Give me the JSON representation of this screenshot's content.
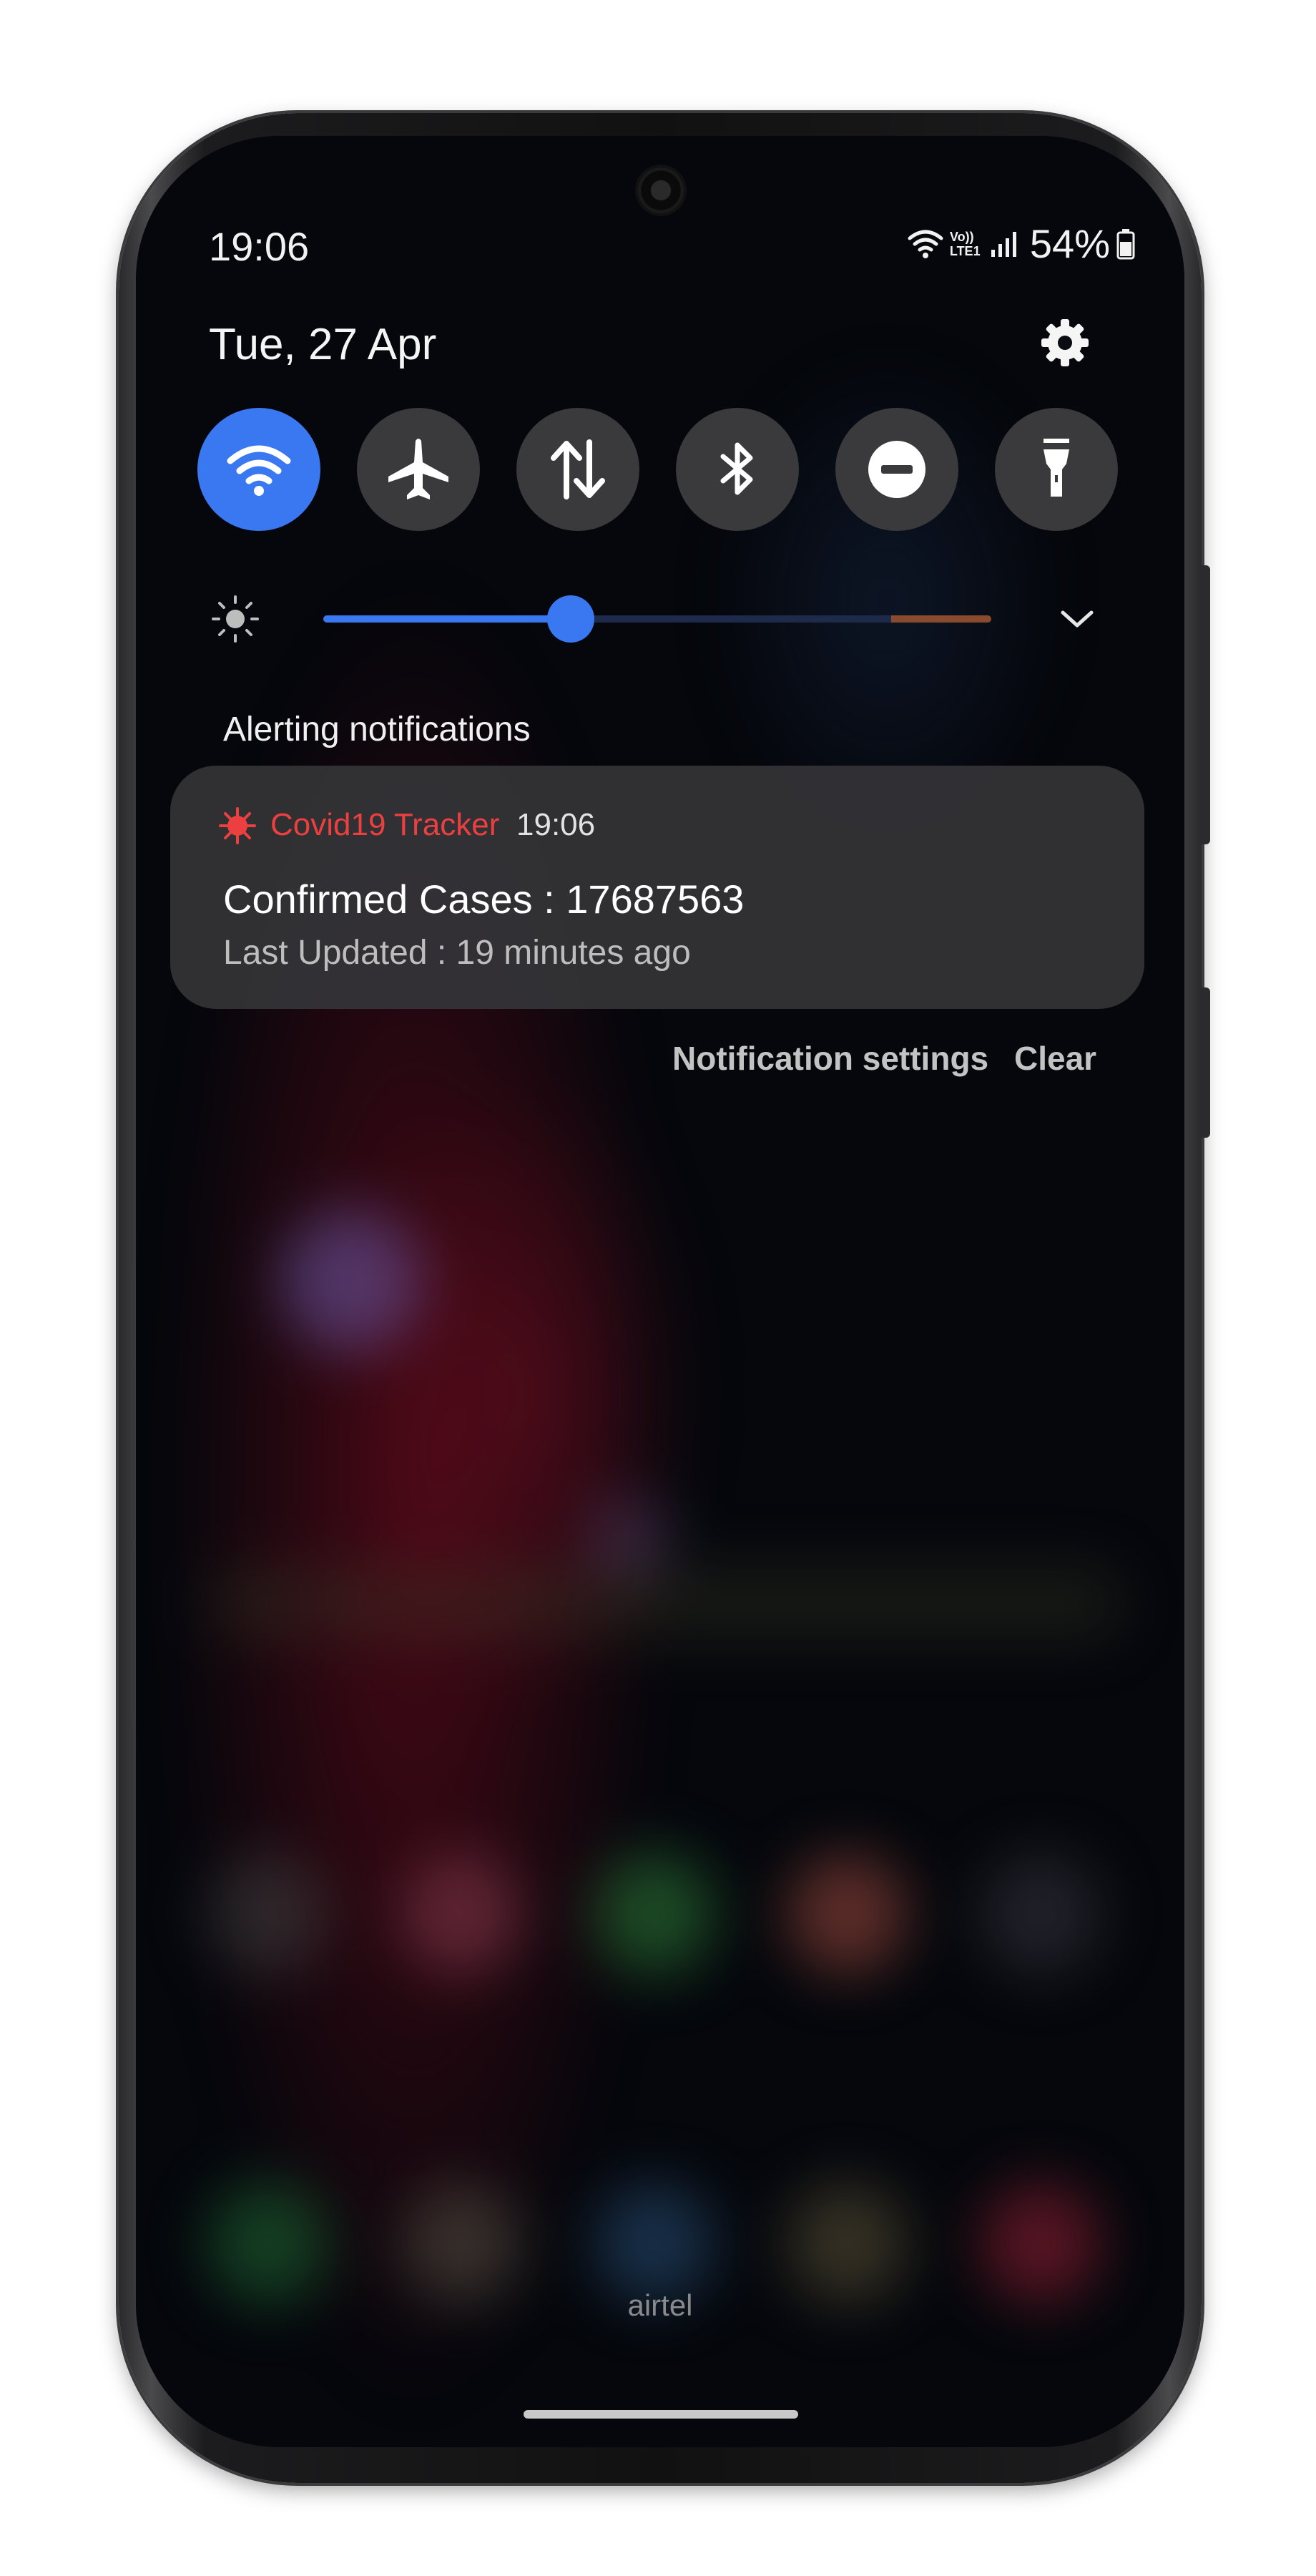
{
  "status_bar": {
    "time": "19:06",
    "network_label": "Vo)) LTE1",
    "battery": "54%"
  },
  "panel": {
    "date": "Tue, 27 Apr",
    "quick_settings": [
      {
        "name": "wifi",
        "icon": "wifi-icon",
        "active": true
      },
      {
        "name": "airplane-mode",
        "icon": "airplane-icon",
        "active": false
      },
      {
        "name": "mobile-data",
        "icon": "data-arrows-icon",
        "active": false
      },
      {
        "name": "bluetooth",
        "icon": "bluetooth-icon",
        "active": false
      },
      {
        "name": "do-not-disturb",
        "icon": "minus-circle-icon",
        "active": false
      },
      {
        "name": "flashlight",
        "icon": "flashlight-icon",
        "active": false
      }
    ],
    "brightness_level": 0.37,
    "accent_color": "#3a78f2"
  },
  "notifications": {
    "section_title": "Alerting notifications",
    "items": [
      {
        "app_name": "Covid19 Tracker",
        "time": "19:06",
        "title": "Confirmed Cases : 17687563",
        "text": "Last Updated : 19 minutes ago",
        "app_color": "#ec3f3f"
      }
    ],
    "settings_label": "Notification settings",
    "clear_label": "Clear"
  },
  "carrier": "airtel"
}
